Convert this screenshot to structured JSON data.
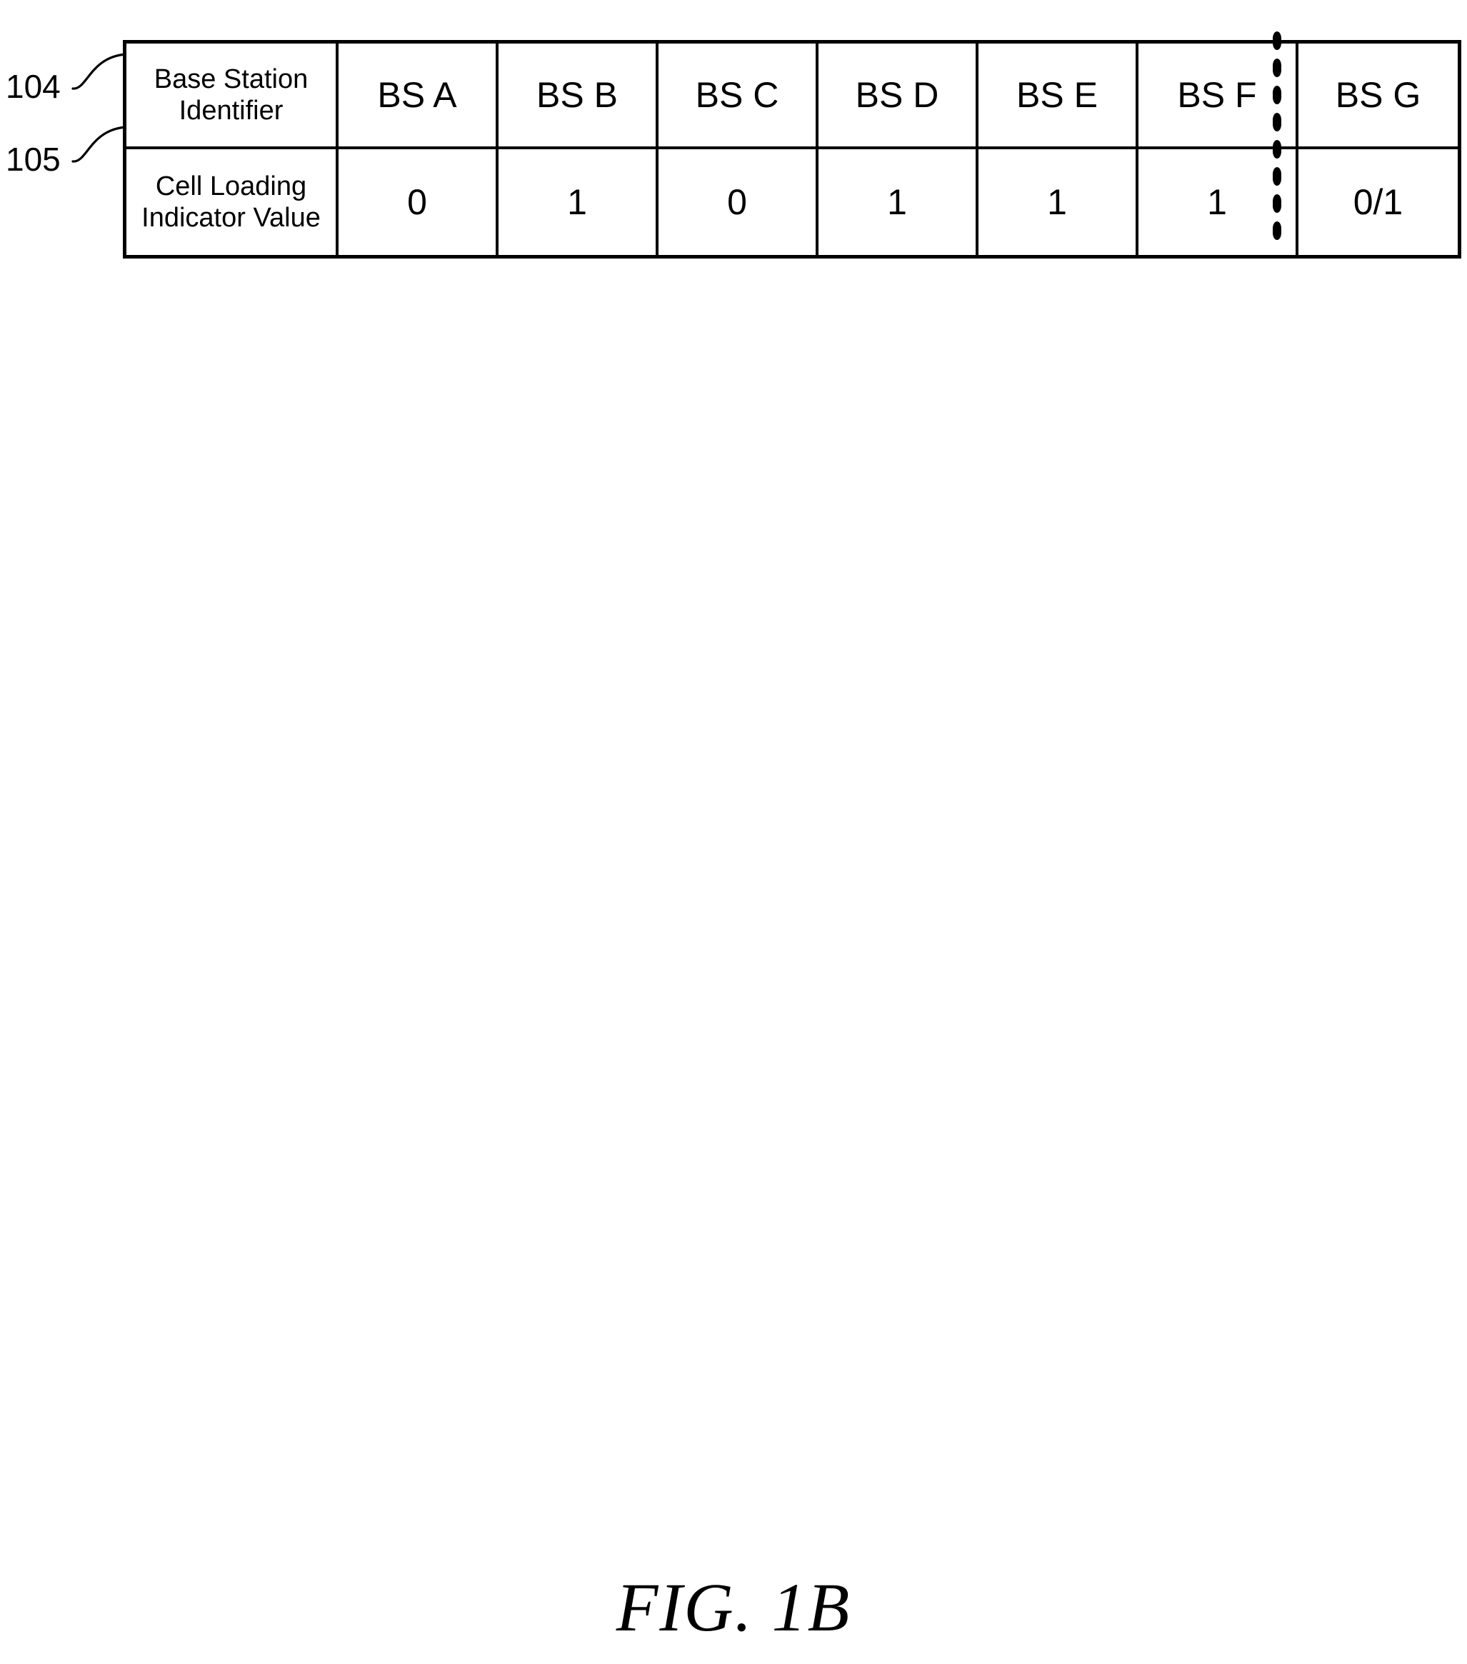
{
  "figure": {
    "caption": "FIG. 1B",
    "reference_numerals": [
      {
        "id": "104",
        "label": "104",
        "points_to": "Base Station Identifier row"
      },
      {
        "id": "105",
        "label": "105",
        "points_to": "Cell Loading Indicator Value row"
      }
    ]
  },
  "table": {
    "row_labels": {
      "base_station_identifier": {
        "line1": "Base Station",
        "line2": "Identifier"
      },
      "cell_loading_indicator_value": {
        "line1": "Cell Loading",
        "line2": "Indicator Value"
      }
    },
    "base_station_identifiers": [
      "BS A",
      "BS B",
      "BS C",
      "BS D",
      "BS E",
      "BS F",
      "BS G"
    ],
    "cell_loading_indicator_values": [
      "0",
      "1",
      "0",
      "1",
      "1",
      "1",
      "0/1"
    ],
    "continuation_divider": {
      "style": "vertical-dotted-line",
      "position": "between BS F and BS G"
    }
  },
  "colors": {
    "ink": "#000000",
    "paper": "#ffffff"
  }
}
